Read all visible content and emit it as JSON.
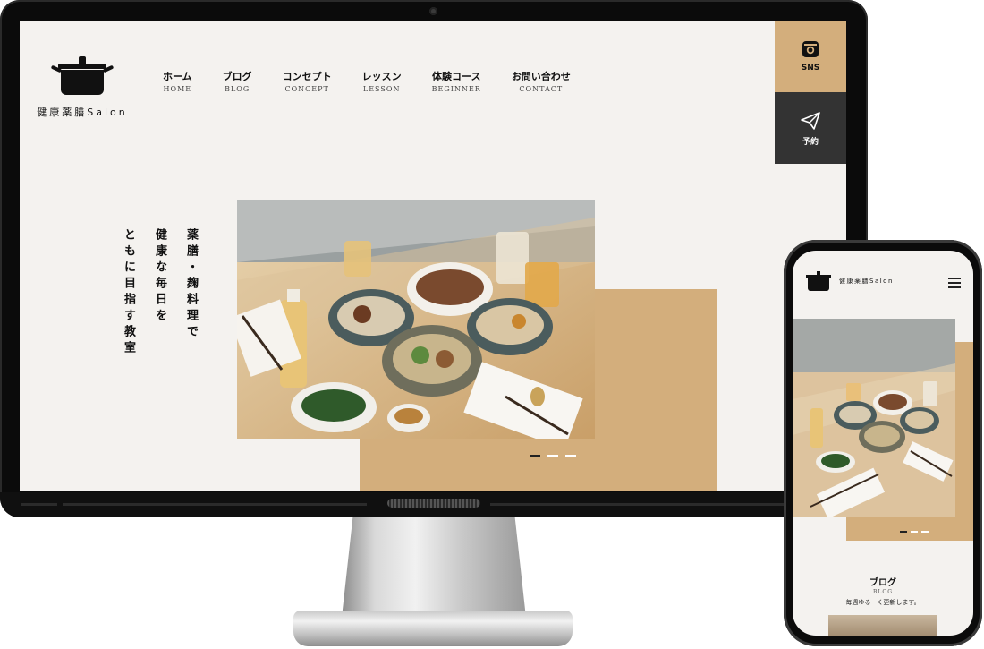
{
  "site": {
    "logo_text": "健康薬膳Salon",
    "nav": [
      {
        "jp": "ホーム",
        "en": "HOME"
      },
      {
        "jp": "ブログ",
        "en": "BLOG"
      },
      {
        "jp": "コンセプト",
        "en": "CONCEPT"
      },
      {
        "jp": "レッスン",
        "en": "LESSON"
      },
      {
        "jp": "体験コース",
        "en": "BEGINNER"
      },
      {
        "jp": "お問い合わせ",
        "en": "CONTACT"
      }
    ],
    "side_buttons": {
      "sns": "SNS",
      "reserve": "予約"
    },
    "tagline": [
      "薬膳・麹料理で",
      "健康な毎日を",
      "ともに目指す教室"
    ],
    "slider": {
      "count": 3,
      "active": 0
    }
  },
  "phone": {
    "logo_text": "健康薬膳Salon",
    "blog": {
      "title_jp": "ブログ",
      "title_en": "BLOG",
      "description": "毎週ゆるーく更新します。"
    }
  },
  "colors": {
    "accent": "#d3ae7c",
    "dark": "#333333",
    "background": "#f4f2ef"
  }
}
